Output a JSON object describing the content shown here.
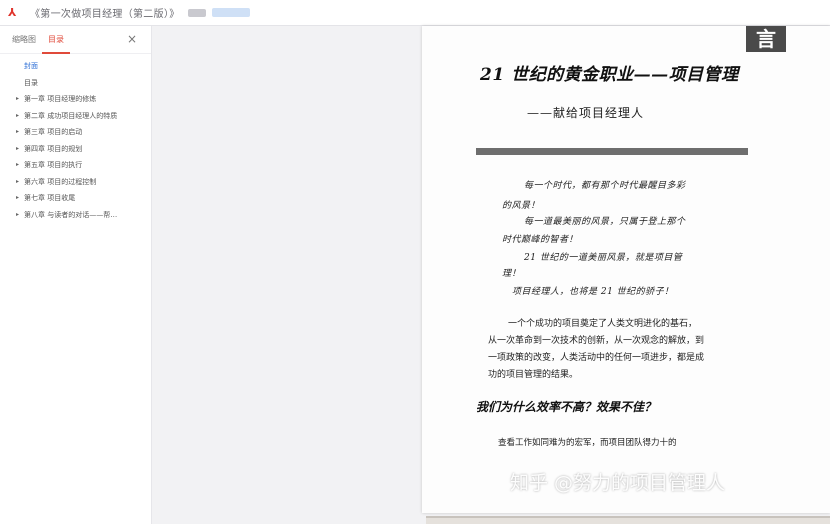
{
  "titlebar": {
    "doc_title": "《第一次做项目经理（第二版）》"
  },
  "sidebar": {
    "tabs": [
      {
        "label": "缩略图"
      },
      {
        "label": "目录"
      }
    ],
    "close_glyph": "×",
    "toc": [
      {
        "label": "封面",
        "expandable": false,
        "selected": true
      },
      {
        "label": "目录",
        "expandable": false,
        "selected": false
      },
      {
        "label": "第一章 项目经理的修炼",
        "expandable": true
      },
      {
        "label": "第二章 成功项目经理人的特质",
        "expandable": true
      },
      {
        "label": "第三章 项目的启动",
        "expandable": true
      },
      {
        "label": "第四章 项目的规划",
        "expandable": true
      },
      {
        "label": "第五章 项目的执行",
        "expandable": true
      },
      {
        "label": "第六章 项目的过程控制",
        "expandable": true
      },
      {
        "label": "第七章 项目收尾",
        "expandable": true
      },
      {
        "label": "第八章 与读者的对话——帮…",
        "expandable": true
      }
    ]
  },
  "page": {
    "marker": "言",
    "title": "21 世纪的黄金职业——项目管理",
    "subtitle": "——献给项目经理人",
    "quotes": [
      "每一个时代，都有那个时代最醒目多彩",
      "的风景！",
      "每一道最美丽的风景，只属于登上那个",
      "时代巅峰的智者！",
      "21 世纪的一道美丽风景，就是项目管",
      "理！",
      "项目经理人，也将是 21 世纪的骄子！"
    ],
    "paragraph": [
      "一个个成功的项目奠定了人类文明进化的基石，",
      "从一次革命到一次技术的创新，从一次观念的解放，到",
      "一项政策的改变，人类活动中的任何一项进步，都是成",
      "功的项目管理的结果。"
    ],
    "section_heading": "我们为什么效率不高？效果不佳？",
    "body_line": "查看工作如同难为的宏军，而项目团队得力十的",
    "watermark": "知乎 @努力的项目管理人"
  },
  "colors": {
    "accent_red": "#e04a3a",
    "selected_blue": "#2e6fd6"
  }
}
